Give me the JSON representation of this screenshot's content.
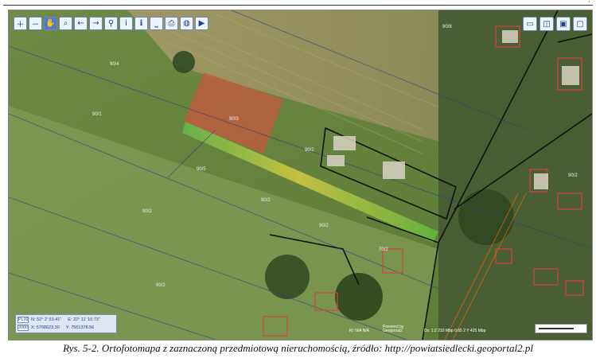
{
  "caption": "Rys. 5-2. Ortofotomapa z zaznaczoną przedmiotową nieruchomością, źródło: http://powiatsiedlecki.geoportal2.pl",
  "corner_mark": "'",
  "toolbar": {
    "tools": [
      {
        "name": "zoom-in-icon",
        "glyph": "＋"
      },
      {
        "name": "zoom-out-icon",
        "glyph": "－"
      },
      {
        "name": "pan-hand-icon",
        "glyph": "✋"
      },
      {
        "name": "zoom-window-icon",
        "glyph": "⌕"
      },
      {
        "name": "back-arrow-icon",
        "glyph": "←"
      },
      {
        "name": "forward-arrow-icon",
        "glyph": "→"
      },
      {
        "name": "link-icon",
        "glyph": "⚲"
      },
      {
        "name": "info-icon",
        "glyph": "i"
      },
      {
        "name": "info-query-icon",
        "glyph": "ℹ"
      },
      {
        "name": "measure-icon",
        "glyph": "⎵"
      },
      {
        "name": "print-icon",
        "glyph": "⎙"
      },
      {
        "name": "globe-icon",
        "glyph": "◍"
      },
      {
        "name": "camera-icon",
        "glyph": "▶"
      }
    ],
    "view_buttons": [
      {
        "name": "layout-full-icon",
        "glyph": "▭"
      },
      {
        "name": "layout-split-icon",
        "glyph": "◫"
      },
      {
        "name": "save-icon",
        "glyph": "▣"
      },
      {
        "name": "window-icon",
        "glyph": "▢"
      }
    ]
  },
  "coordinates": {
    "badge1": "PL92",
    "badge2": "2000",
    "n": "N: 52° 2' 53.41\"",
    "e": "E: 22° 11' 10.73\"",
    "x": "X: 5768623.30",
    "y": "Y: 7551378.56"
  },
  "status": {
    "left": "Kl: N/A  N/A",
    "mid": "Powered by Geoportal2",
    "right": "Dz: 1:2 210 Mbp  0.65 2 Y 425 Mbp"
  },
  "parcels": [
    "90/4",
    "90/1",
    "90/3",
    "90/2",
    "90/5",
    "90/2",
    "90/2",
    "90/2",
    "70/2",
    "90/2",
    "90/8",
    "90/2"
  ]
}
